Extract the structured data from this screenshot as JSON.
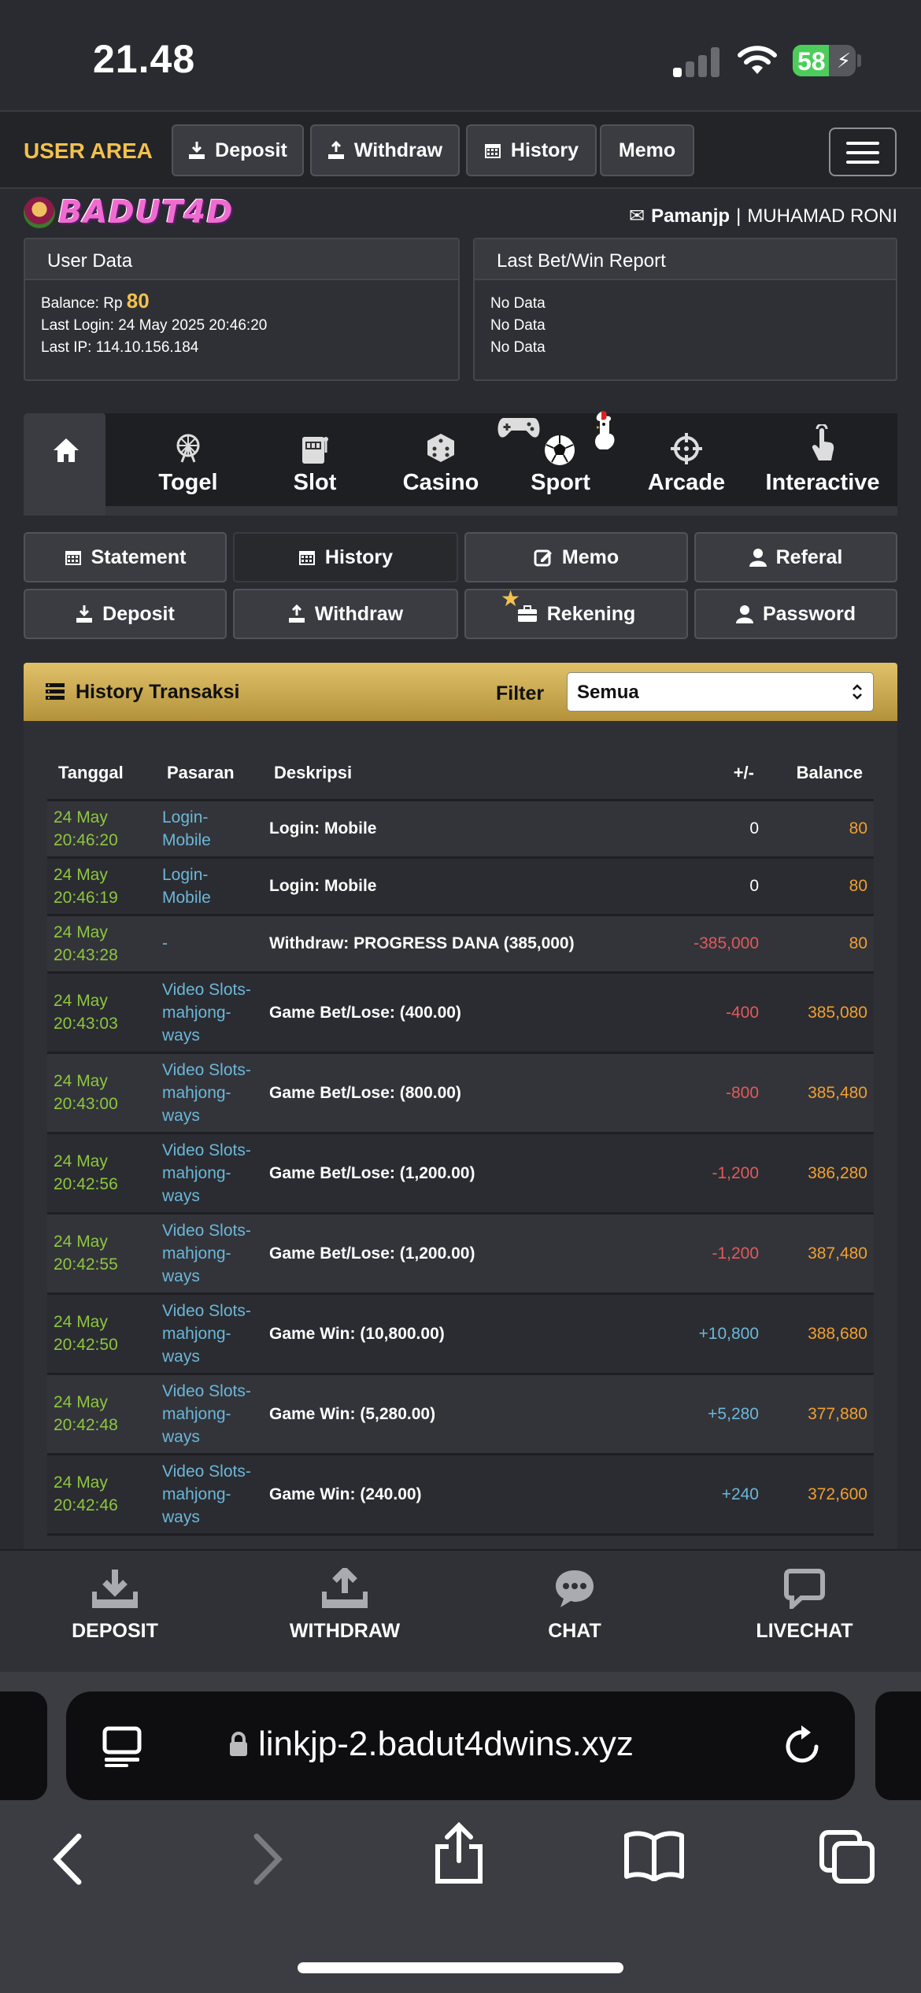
{
  "status": {
    "time": "21.48",
    "battery": "58",
    "battery_level": 0.58
  },
  "topnav": {
    "user_area": "USER AREA",
    "buttons": [
      "Deposit",
      "Withdraw",
      "History",
      "Memo"
    ]
  },
  "brand": {
    "name": "BADUT4D"
  },
  "user": {
    "username": "Pamanjp",
    "separator": "|",
    "fullname": "MUHAMAD RONI"
  },
  "user_data": {
    "title": "User Data",
    "balance_label": "Balance: Rp",
    "balance": "80",
    "last_login": "Last Login: 24 May 2025 20:46:20",
    "last_ip": "Last IP: 114.10.156.184"
  },
  "last_bet": {
    "title": "Last Bet/Win Report",
    "lines": [
      "No Data",
      "No Data",
      "No Data"
    ]
  },
  "categories": [
    "Togel",
    "Slot",
    "Casino",
    "Sport",
    "Arcade",
    "Interactive"
  ],
  "submenu": {
    "row1": [
      "Statement",
      "History",
      "Memo",
      "Referal"
    ],
    "row2": [
      "Deposit",
      "Withdraw",
      "Rekening",
      "Password"
    ]
  },
  "history": {
    "title": "History Transaksi",
    "filter_label": "Filter",
    "filter_value": "Semua",
    "columns": [
      "Tanggal",
      "Pasaran",
      "Deskripsi",
      "+/-",
      "Balance"
    ],
    "rows": [
      {
        "date": "24 May 20:46:20",
        "market": "Login-Mobile",
        "desc": "Login: Mobile",
        "amount": "0",
        "balance": "80"
      },
      {
        "date": "24 May 20:46:19",
        "market": "Login-Mobile",
        "desc": "Login: Mobile",
        "amount": "0",
        "balance": "80"
      },
      {
        "date": "24 May 20:43:28",
        "market": "-",
        "desc": "Withdraw: PROGRESS DANA (385,000)",
        "amount": "-385,000",
        "balance": "80"
      },
      {
        "date": "24 May 20:43:03",
        "market": "Video Slots-mahjong-ways",
        "desc": "Game Bet/Lose: (400.00)",
        "amount": "-400",
        "balance": "385,080"
      },
      {
        "date": "24 May 20:43:00",
        "market": "Video Slots-mahjong-ways",
        "desc": "Game Bet/Lose: (800.00)",
        "amount": "-800",
        "balance": "385,480"
      },
      {
        "date": "24 May 20:42:56",
        "market": "Video Slots-mahjong-ways",
        "desc": "Game Bet/Lose: (1,200.00)",
        "amount": "-1,200",
        "balance": "386,280"
      },
      {
        "date": "24 May 20:42:55",
        "market": "Video Slots-mahjong-ways",
        "desc": "Game Bet/Lose: (1,200.00)",
        "amount": "-1,200",
        "balance": "387,480"
      },
      {
        "date": "24 May 20:42:50",
        "market": "Video Slots-mahjong-ways",
        "desc": "Game Win: (10,800.00)",
        "amount": "+10,800",
        "balance": "388,680"
      },
      {
        "date": "24 May 20:42:48",
        "market": "Video Slots-mahjong-ways",
        "desc": "Game Win: (5,280.00)",
        "amount": "+5,280",
        "balance": "377,880"
      },
      {
        "date": "24 May 20:42:46",
        "market": "Video Slots-mahjong-ways",
        "desc": "Game Win: (240.00)",
        "amount": "+240",
        "balance": "372,600"
      }
    ]
  },
  "tabbar": [
    "DEPOSIT",
    "WITHDRAW",
    "CHAT",
    "LIVECHAT"
  ],
  "browser": {
    "url": "linkjp-2.badut4dwins.xyz"
  },
  "colors": {
    "accent_gold": "#f2c14e",
    "date_green": "#8dc63f",
    "link_blue": "#6bb7d9",
    "negative_red": "#e05a5a",
    "balance_orange": "#f0a030"
  }
}
